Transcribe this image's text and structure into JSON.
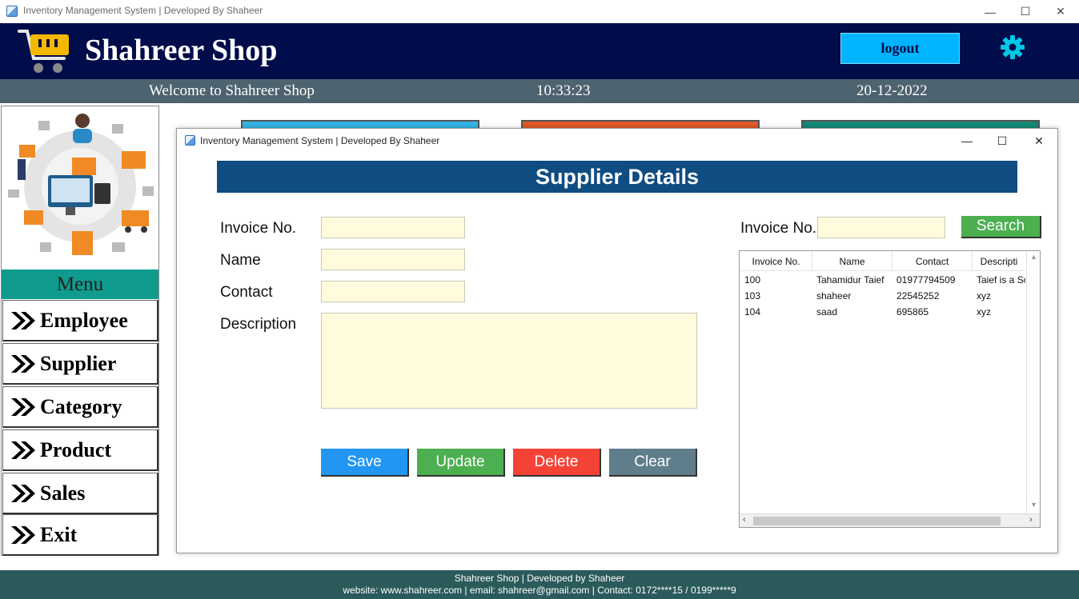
{
  "window": {
    "title": "Inventory Management System | Developed By Shaheer",
    "minimize": "—",
    "maximize": "☐",
    "close": "✕"
  },
  "header": {
    "shop_name": "Shahreer Shop",
    "logout_label": "logout",
    "accent_color": "#010c4a"
  },
  "subheader": {
    "welcome": "Welcome to Shahreer Shop",
    "time": "10:33:23",
    "date": "20-12-2022"
  },
  "sidebar": {
    "menu_title": "Menu",
    "items": [
      {
        "label": "Employee"
      },
      {
        "label": "Supplier"
      },
      {
        "label": "Category"
      },
      {
        "label": "Product"
      },
      {
        "label": "Sales"
      },
      {
        "label": "Exit"
      }
    ]
  },
  "dialog": {
    "title": "Inventory Management System | Developed By Shaheer",
    "banner": "Supplier Details",
    "form": {
      "invoice_label": "Invoice No.",
      "name_label": "Name",
      "contact_label": "Contact",
      "description_label": "Description",
      "invoice_value": "",
      "name_value": "",
      "contact_value": "",
      "description_value": ""
    },
    "buttons": {
      "save": "Save",
      "update": "Update",
      "delete": "Delete",
      "clear": "Clear"
    },
    "search": {
      "label": "Invoice No.",
      "value": "",
      "button": "Search"
    },
    "table": {
      "columns": [
        "Invoice No.",
        "Name",
        "Contact",
        "Descripti"
      ],
      "rows": [
        [
          "100",
          "Tahamidur Taief",
          "01977794509",
          "Taief is a So"
        ],
        [
          "103",
          "shaheer",
          "22545252",
          "xyz"
        ],
        [
          "104",
          "saad",
          "695865",
          "xyz"
        ]
      ]
    }
  },
  "footer": {
    "line1": "Shahreer Shop  |  Developed by Shaheer",
    "line2": "website: www.shahreer.com     |     email: shahreer@gmail.com     |     Contact: 0172****15 / 0199*****9"
  }
}
